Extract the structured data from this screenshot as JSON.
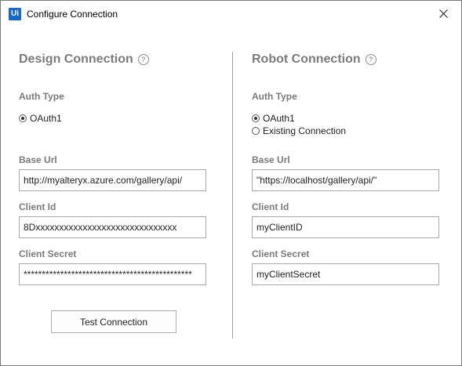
{
  "window": {
    "title": "Configure Connection",
    "app_icon_text": "Ui"
  },
  "design": {
    "heading": "Design Connection",
    "help_glyph": "?",
    "auth_type_label": "Auth Type",
    "auth_options": [
      {
        "label": "OAuth1",
        "checked": true
      }
    ],
    "base_url_label": "Base Url",
    "base_url_value": "http://myalteryx.azure.com/gallery/api/",
    "client_id_label": "Client Id",
    "client_id_value": "8Dxxxxxxxxxxxxxxxxxxxxxxxxxxxxxx",
    "client_secret_label": "Client Secret",
    "client_secret_value": "**********************************************",
    "test_button_label": "Test Connection"
  },
  "robot": {
    "heading": "Robot Connection",
    "help_glyph": "?",
    "auth_type_label": "Auth Type",
    "auth_options": [
      {
        "label": "OAuth1",
        "checked": true
      },
      {
        "label": "Existing Connection",
        "checked": false
      }
    ],
    "base_url_label": "Base Url",
    "base_url_value": "\"https://localhost/gallery/api/\"",
    "client_id_label": "Client Id",
    "client_id_value": "myClientID",
    "client_secret_label": "Client Secret",
    "client_secret_value": "myClientSecret"
  },
  "icons": {
    "app": "uipath-logo-icon",
    "close": "close-icon",
    "help": "help-icon"
  },
  "colors": {
    "accent": "#1767c9",
    "section_text": "#7b7b7b",
    "border": "#a9a9a9"
  }
}
